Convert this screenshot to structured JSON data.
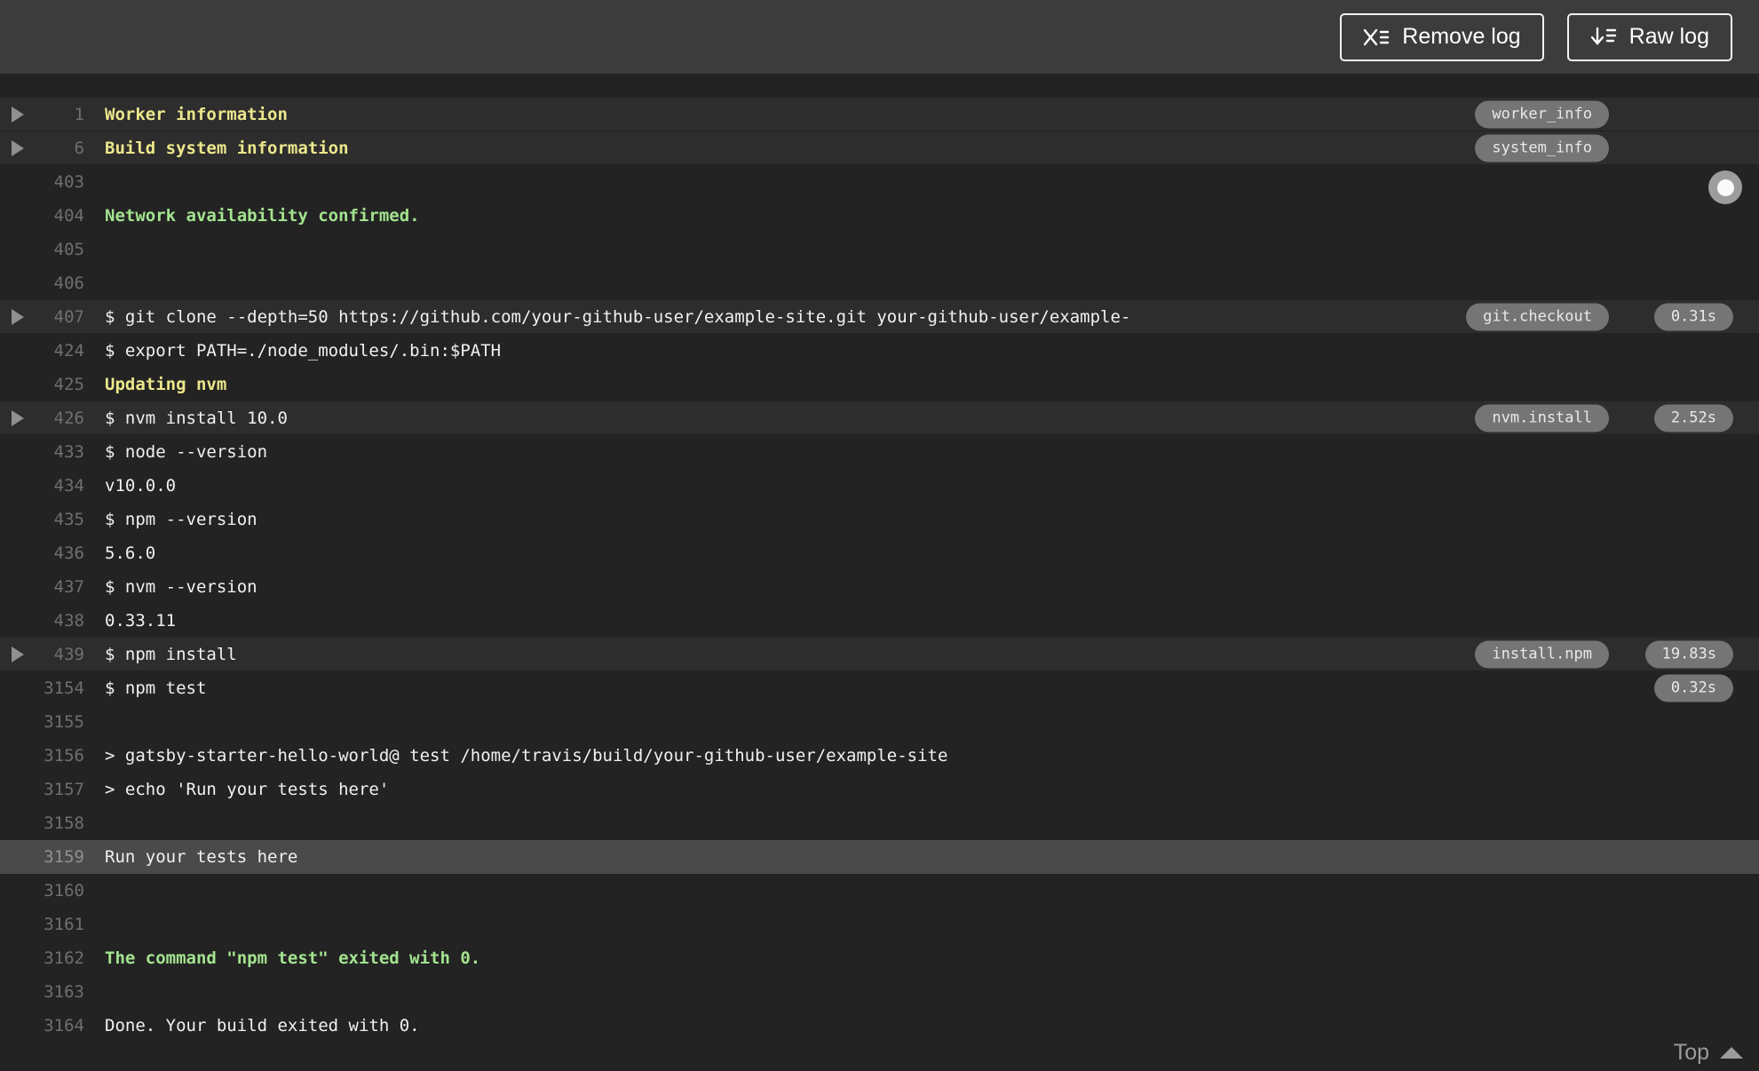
{
  "header": {
    "buttons": [
      {
        "id": "remove-log",
        "label": "Remove log"
      },
      {
        "id": "raw-log",
        "label": "Raw log"
      }
    ]
  },
  "log": {
    "rows": [
      {
        "num": "1",
        "text": "Worker information",
        "style": "yellow",
        "fold": true,
        "badge": "worker_info"
      },
      {
        "num": "6",
        "text": "Build system information",
        "style": "yellow",
        "fold": true,
        "badge": "system_info"
      },
      {
        "num": "403",
        "text": ""
      },
      {
        "num": "404",
        "text": "Network availability confirmed.",
        "style": "green"
      },
      {
        "num": "405",
        "text": ""
      },
      {
        "num": "406",
        "text": ""
      },
      {
        "num": "407",
        "text": "$ git clone --depth=50 https://github.com/your-github-user/example-site.git your-github-user/example-",
        "fold": true,
        "badge": "git.checkout",
        "duration": "0.31s"
      },
      {
        "num": "424",
        "text": "$ export PATH=./node_modules/.bin:$PATH"
      },
      {
        "num": "425",
        "text": "Updating nvm",
        "style": "yellow"
      },
      {
        "num": "426",
        "text": "$ nvm install 10.0",
        "fold": true,
        "badge": "nvm.install",
        "duration": "2.52s"
      },
      {
        "num": "433",
        "text": "$ node --version"
      },
      {
        "num": "434",
        "text": "v10.0.0"
      },
      {
        "num": "435",
        "text": "$ npm --version"
      },
      {
        "num": "436",
        "text": "5.6.0"
      },
      {
        "num": "437",
        "text": "$ nvm --version"
      },
      {
        "num": "438",
        "text": "0.33.11"
      },
      {
        "num": "439",
        "text": "$ npm install",
        "fold": true,
        "badge": "install.npm",
        "duration": "19.83s"
      },
      {
        "num": "3154",
        "text": "$ npm test",
        "duration": "0.32s"
      },
      {
        "num": "3155",
        "text": ""
      },
      {
        "num": "3156",
        "text": "> gatsby-starter-hello-world@ test /home/travis/build/your-github-user/example-site"
      },
      {
        "num": "3157",
        "text": "> echo 'Run your tests here'"
      },
      {
        "num": "3158",
        "text": ""
      },
      {
        "num": "3159",
        "text": "Run your tests here",
        "selected": true
      },
      {
        "num": "3160",
        "text": ""
      },
      {
        "num": "3161",
        "text": ""
      },
      {
        "num": "3162",
        "text": "The command \"npm test\" exited with 0.",
        "style": "green"
      },
      {
        "num": "3163",
        "text": ""
      },
      {
        "num": "3164",
        "text": "Done. Your build exited with 0."
      }
    ],
    "top_link": {
      "label": "Top"
    }
  },
  "colors": {
    "header_bg": "#3c3c3c",
    "log_bg": "#232323",
    "fold_row_bg": "#2d2d2d",
    "selected_row_bg": "#4a4a4a",
    "yellow": "#ece78c",
    "green": "#a3e38f",
    "text": "#f1f1f1",
    "line_number": "#6f6f6f",
    "badge_bg": "#757575"
  }
}
